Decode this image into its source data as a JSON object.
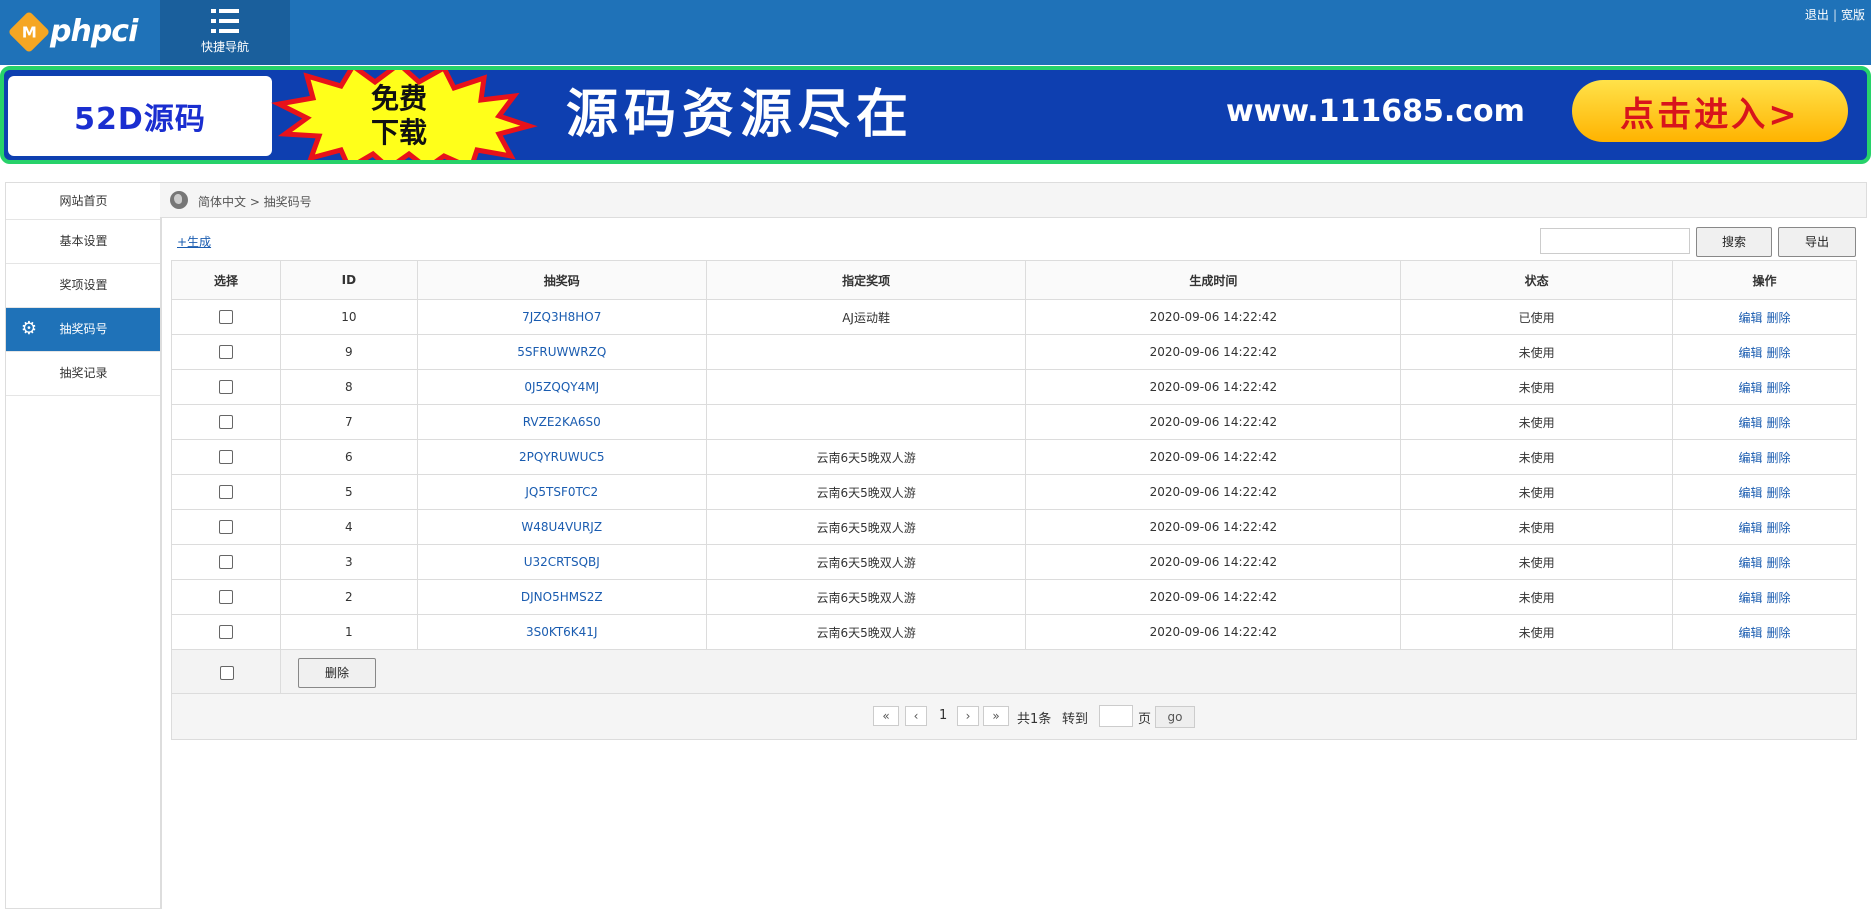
{
  "header": {
    "logo_mark": "M",
    "logo_text": "phpci",
    "quicknav_label": "快捷导航",
    "logout": "退出",
    "wide": "宽版"
  },
  "banner": {
    "brand": "52D源码",
    "badge": [
      "免费",
      "下载"
    ],
    "headline": "源码资源尽在",
    "url": "www.111685.com",
    "cta": "点击进入>"
  },
  "sidebar": {
    "items": [
      {
        "label": "网站首页",
        "active": false
      },
      {
        "label": "基本设置",
        "active": false
      },
      {
        "label": "奖项设置",
        "active": false
      },
      {
        "label": "抽奖码号",
        "active": true
      },
      {
        "label": "抽奖记录",
        "active": false
      }
    ]
  },
  "breadcrumb": {
    "text": "简体中文 > 抽奖码号"
  },
  "toolbar": {
    "generate": "+生成",
    "search_value": "",
    "search_btn": "搜索",
    "export_btn": "导出"
  },
  "table": {
    "headers": [
      "选择",
      "ID",
      "抽奖码",
      "指定奖项",
      "生成时间",
      "状态",
      "操作"
    ],
    "rows": [
      {
        "id": "10",
        "code": "7JZQ3H8HO7",
        "prize": "AJ运动鞋",
        "time": "2020-09-06 14:22:42",
        "status": "已使用"
      },
      {
        "id": "9",
        "code": "5SFRUWWRZQ",
        "prize": "",
        "time": "2020-09-06 14:22:42",
        "status": "未使用"
      },
      {
        "id": "8",
        "code": "0J5ZQQY4MJ",
        "prize": "",
        "time": "2020-09-06 14:22:42",
        "status": "未使用"
      },
      {
        "id": "7",
        "code": "RVZE2KA6S0",
        "prize": "",
        "time": "2020-09-06 14:22:42",
        "status": "未使用"
      },
      {
        "id": "6",
        "code": "2PQYRUWUC5",
        "prize": "云南6天5晚双人游",
        "time": "2020-09-06 14:22:42",
        "status": "未使用"
      },
      {
        "id": "5",
        "code": "JQ5TSF0TC2",
        "prize": "云南6天5晚双人游",
        "time": "2020-09-06 14:22:42",
        "status": "未使用"
      },
      {
        "id": "4",
        "code": "W48U4VURJZ",
        "prize": "云南6天5晚双人游",
        "time": "2020-09-06 14:22:42",
        "status": "未使用"
      },
      {
        "id": "3",
        "code": "U32CRTSQBJ",
        "prize": "云南6天5晚双人游",
        "time": "2020-09-06 14:22:42",
        "status": "未使用"
      },
      {
        "id": "2",
        "code": "DJNO5HMS2Z",
        "prize": "云南6天5晚双人游",
        "time": "2020-09-06 14:22:42",
        "status": "未使用"
      },
      {
        "id": "1",
        "code": "3S0KT6K41J",
        "prize": "云南6天5晚双人游",
        "time": "2020-09-06 14:22:42",
        "status": "未使用"
      }
    ],
    "edit_label": "编辑",
    "delete_label": "删除"
  },
  "footer": {
    "delete_btn": "删除"
  },
  "pager": {
    "first": "«",
    "prev": "‹",
    "current": "1",
    "next": "›",
    "last": "»",
    "total": "共1条",
    "goto": "转到",
    "page_value": "",
    "page_unit": "页",
    "go": "go"
  }
}
